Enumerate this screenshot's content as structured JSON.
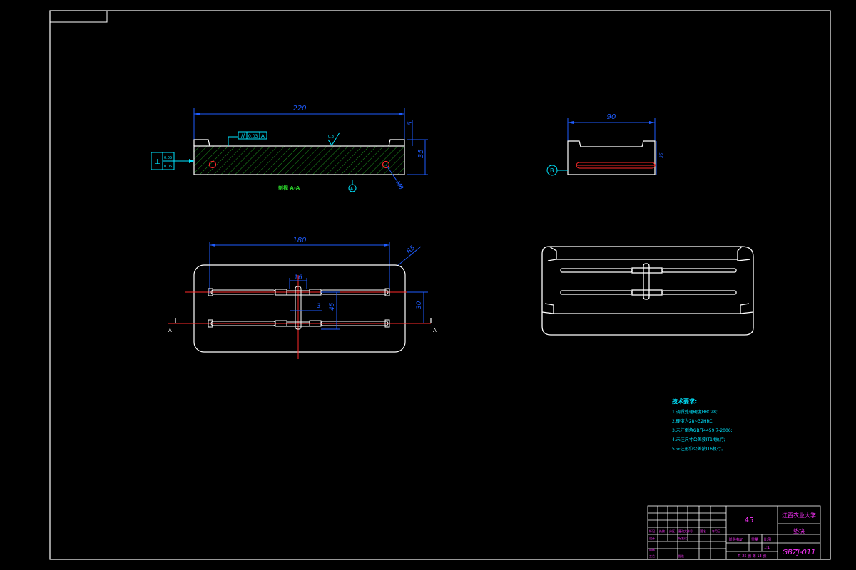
{
  "drawing": {
    "section_view": {
      "label": "剖视 A-A",
      "dim_length": "220",
      "dim_height": "35",
      "dim_step": "5",
      "flatness_value": "0.03",
      "flatness_datum": "A",
      "perp_value_1": "0.05",
      "perp_value_2": "0.05",
      "surface_finish": "0.8",
      "callout_m": "M8",
      "datum_marker": "A"
    },
    "side_view": {
      "dim_width": "90",
      "dim_height": "35",
      "datum_label": "B"
    },
    "plan_view": {
      "dim_span": "180",
      "dim_corner": "R5",
      "dim_gap": "16",
      "dim_small": "3",
      "dim_pitch": "45",
      "dim_row": "30",
      "section_mark_left": "A",
      "section_mark_right": "A"
    },
    "notes": {
      "title": "技术要求:",
      "items": [
        "1.调质处理硬度HRC28;",
        "2.硬度为28~32HRC;",
        "3.未注倒角GB/T4459.7-2006;",
        "4.未注尺寸公差按IT14执行;",
        "5.未注形位公差按IT6执行。"
      ]
    },
    "title_block": {
      "material": "45",
      "school": "江西农业大学",
      "part_name": "垫块",
      "drawing_no": "GBZJ-011",
      "scale_label": "比例",
      "scale_value": "1:1",
      "weight_label": "重量",
      "stage_label": "阶段标记",
      "sheets": "共 25 张  第 13 张",
      "row_labels": [
        "标记",
        "处数",
        "分区",
        "更改文件号",
        "签名",
        "年月日"
      ],
      "row_labels2": [
        "设计",
        "标准化"
      ],
      "row_labels3": [
        "审核",
        "工艺",
        "批准"
      ]
    }
  },
  "colors": {
    "background": "#000000",
    "frame": "#ffffff",
    "dimension": "#1e5cff",
    "centerline": "#ff2a2a",
    "hatch": "#2ad12a",
    "annotation": "#00e5ff",
    "title_text": "#ff33ff"
  }
}
